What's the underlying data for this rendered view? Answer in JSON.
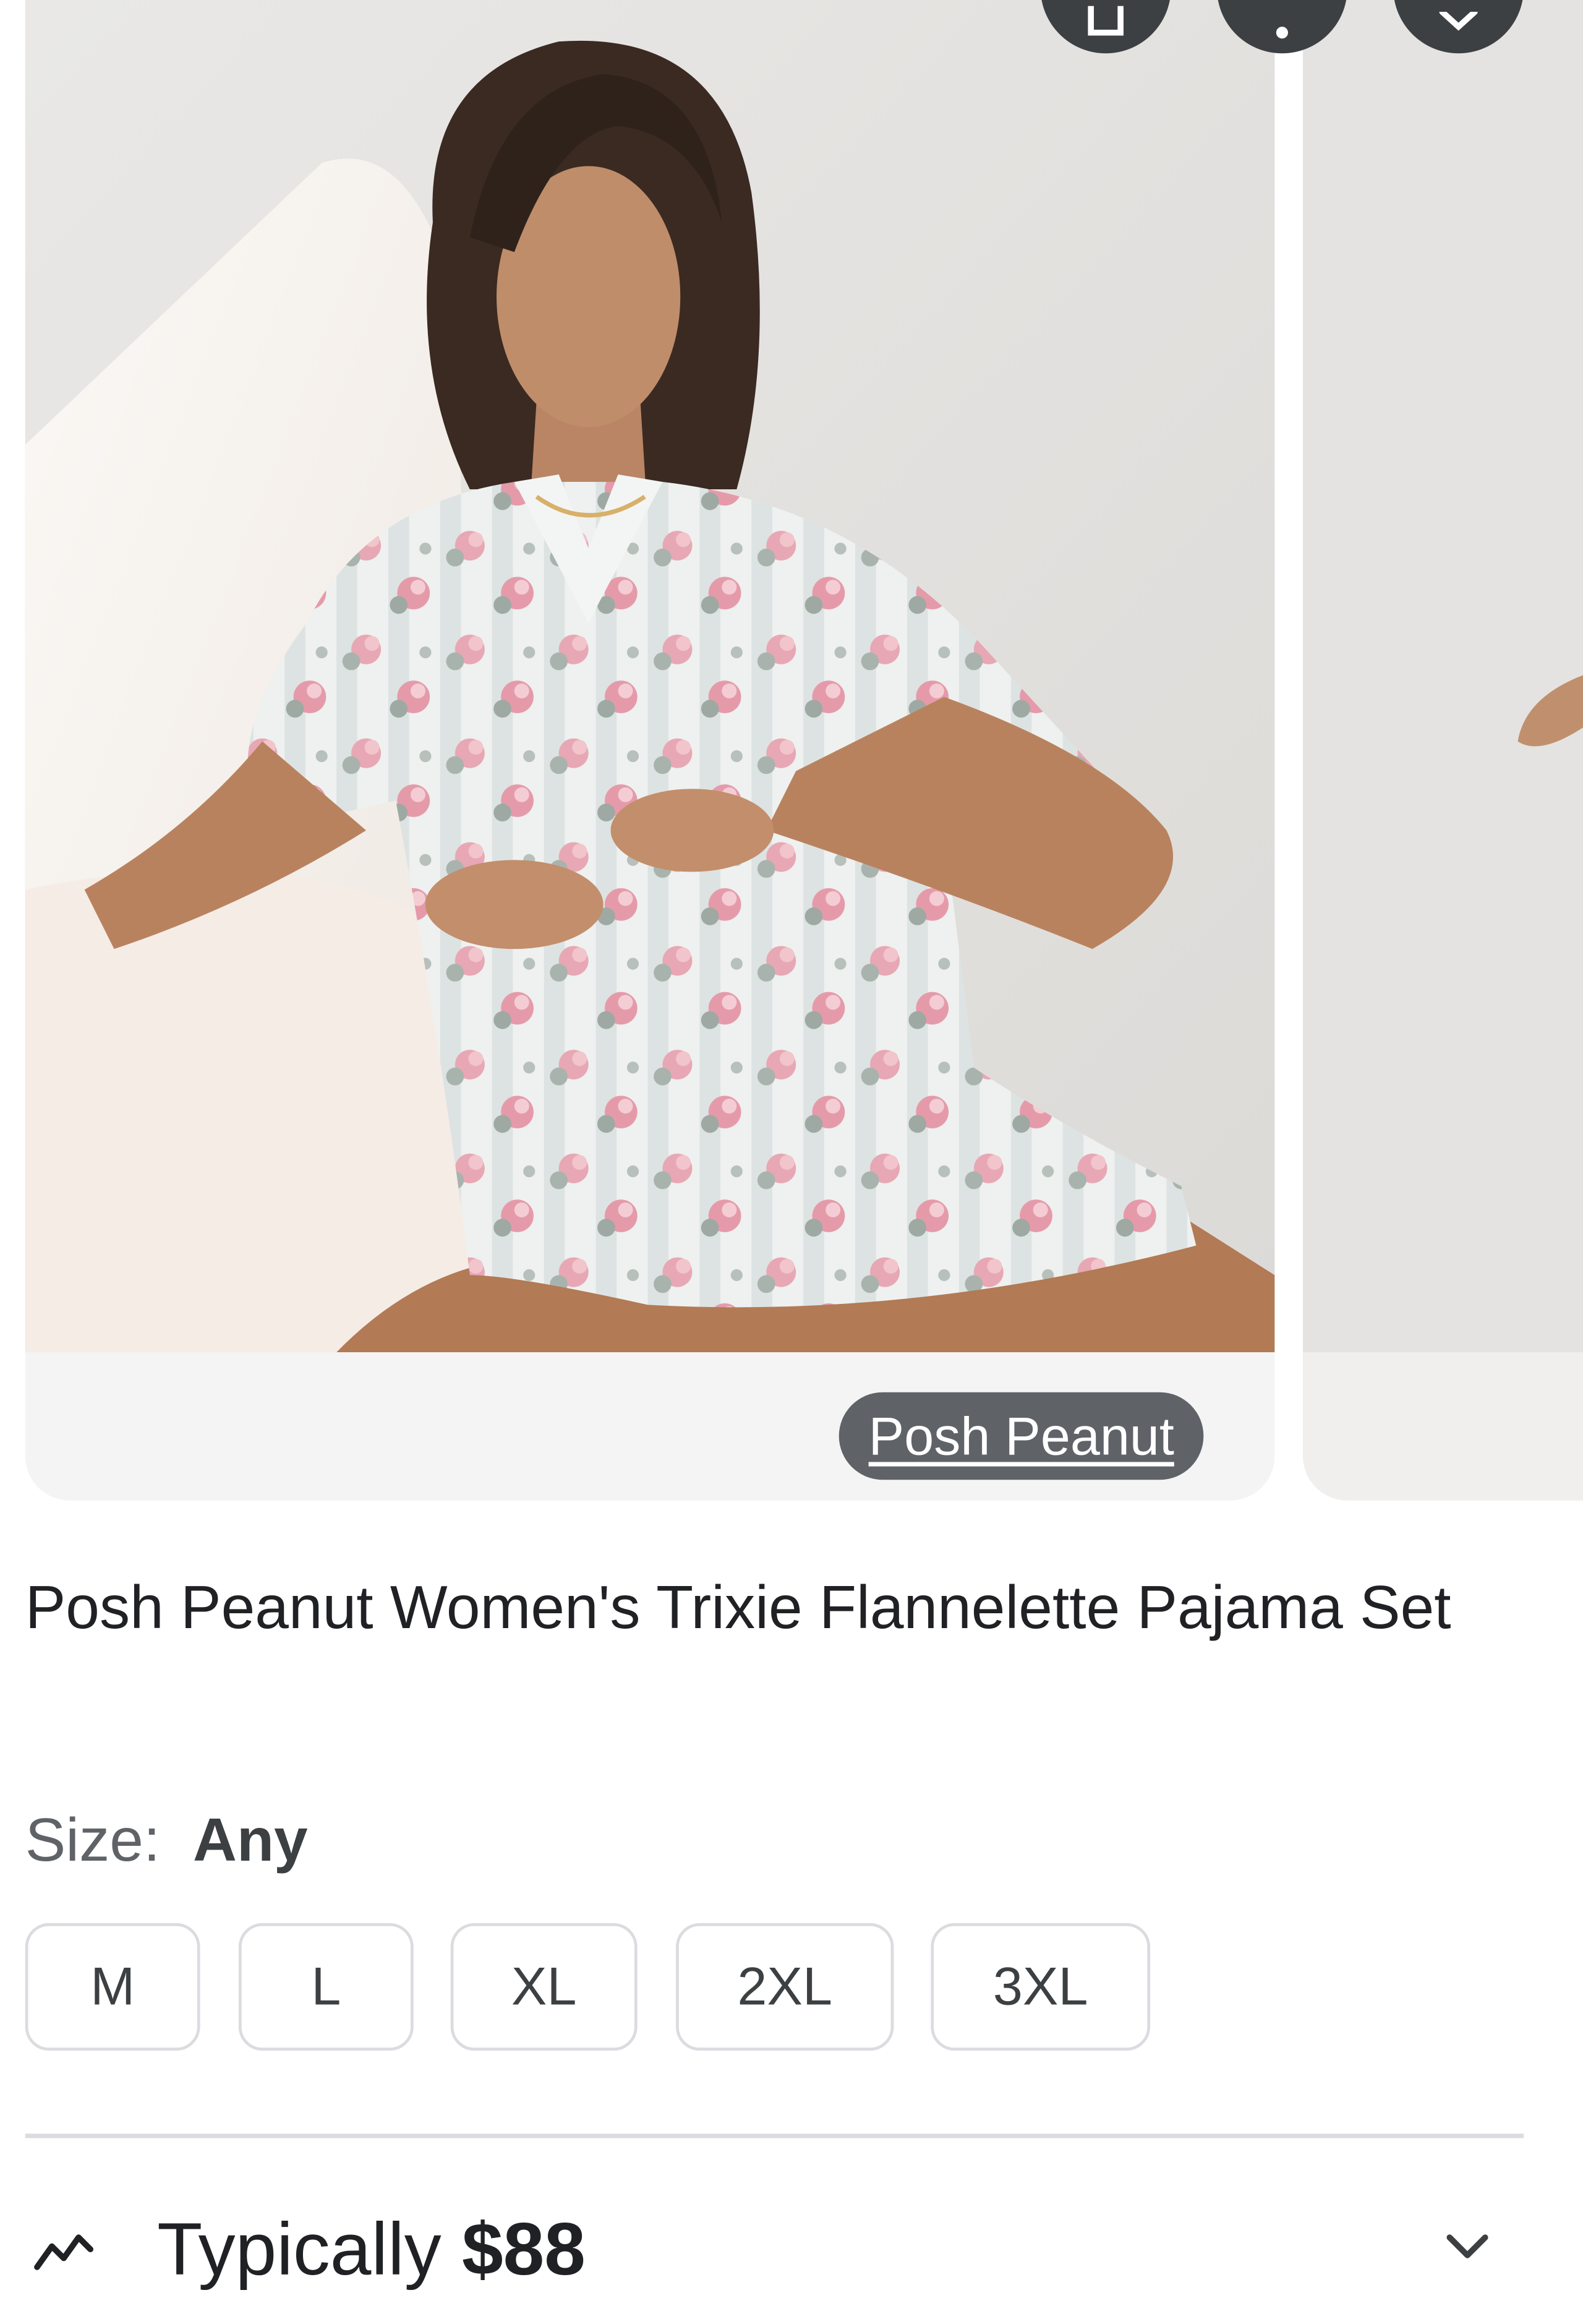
{
  "source": {
    "label": "Posh Peanut"
  },
  "product": {
    "title": "Posh Peanut Women's Trixie Flannelette Pajama Set"
  },
  "size": {
    "label": "Size:",
    "selected": "Any",
    "options": [
      "M",
      "L",
      "XL",
      "2XL",
      "3XL"
    ]
  },
  "price": {
    "prefix": "Typically",
    "value": "$88"
  },
  "colors": {
    "chip": "#5f6368",
    "chip_text": "#ffffff",
    "border": "#dadce0",
    "text": "#202124"
  },
  "icons": {
    "top_buttons": [
      "share-icon",
      "more-vert-icon",
      "close-icon"
    ],
    "price_trend": "trending-line-icon",
    "expand": "chevron-down-icon"
  }
}
